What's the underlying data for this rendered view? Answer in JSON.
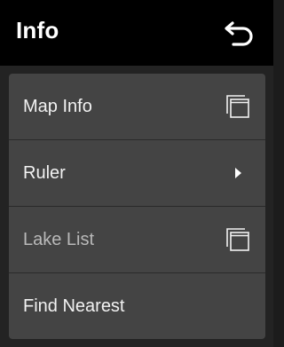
{
  "header": {
    "title": "Info",
    "back_icon": "back-arrow-icon"
  },
  "menu": {
    "items": [
      {
        "label": "Map Info",
        "icon": "window-stack-icon",
        "state": "enabled"
      },
      {
        "label": "Ruler",
        "icon": "chevron-right-icon",
        "state": "enabled"
      },
      {
        "label": "Lake List",
        "icon": "window-stack-icon",
        "state": "disabled"
      },
      {
        "label": "Find Nearest",
        "icon": "",
        "state": "enabled"
      }
    ]
  },
  "colors": {
    "header_bg": "#000000",
    "panel_bg": "#444444",
    "screen_bg": "#232323",
    "text": "#f2f2f2",
    "text_disabled": "#b9b9b9"
  }
}
